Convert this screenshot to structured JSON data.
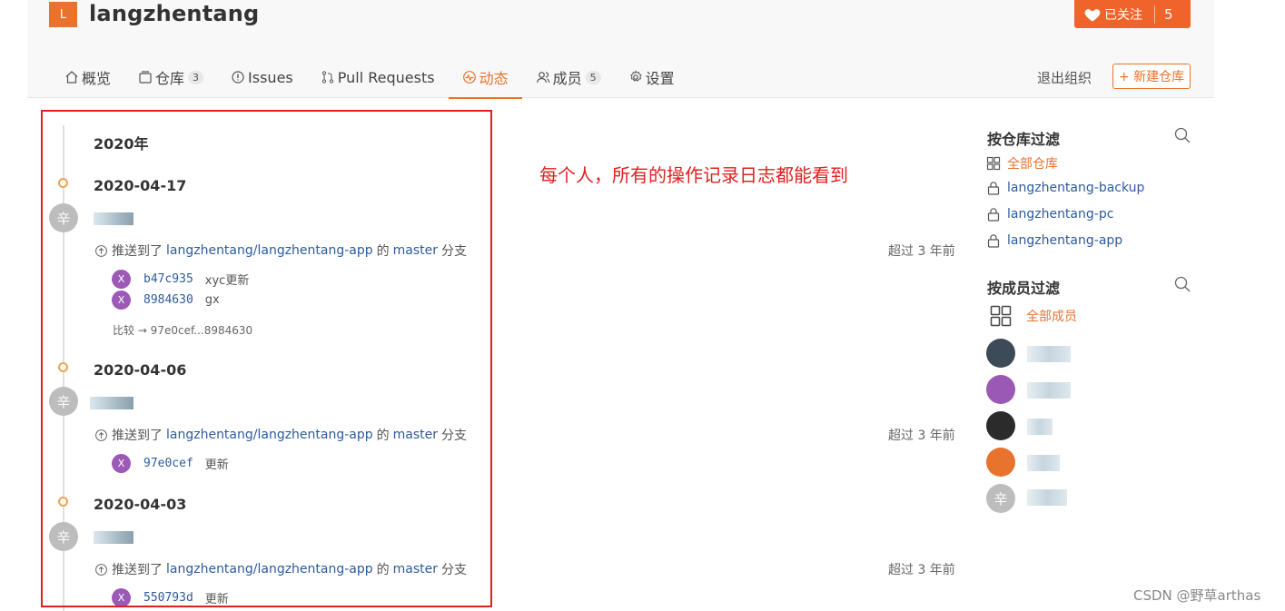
{
  "org": {
    "logo_letter": "L",
    "name": "langzhentang",
    "follow_label": "已关注",
    "follow_count": "5"
  },
  "tabs": [
    {
      "label": "概览",
      "icon": "home-icon"
    },
    {
      "label": "仓库",
      "icon": "repo-icon",
      "badge": "3"
    },
    {
      "label": "Issues",
      "icon": "issue-icon"
    },
    {
      "label": "Pull Requests",
      "icon": "pull-request-icon"
    },
    {
      "label": "动态",
      "icon": "activity-icon",
      "active": true
    },
    {
      "label": "成员",
      "icon": "members-icon",
      "badge": "5"
    },
    {
      "label": "设置",
      "icon": "gear-icon"
    }
  ],
  "header_actions": {
    "quit_org": "退出组织",
    "new_repo": "+ 新建仓库"
  },
  "timeline": {
    "year": "2020年",
    "avatar_char": "辛",
    "events": [
      {
        "date": "2020-04-17",
        "action": {
          "prefix": "推送到了",
          "repo": "langzhentang/langzhentang-app",
          "of": "的",
          "branch": "master",
          "suffix": "分支"
        },
        "time_ago": "超过 3 年前",
        "commits": [
          {
            "avatar": "X",
            "sha": "b47c935",
            "message": "xyc更新"
          },
          {
            "avatar": "X",
            "sha": "8984630",
            "message": "gx"
          }
        ],
        "compare": "比较 → 97e0cef...8984630"
      },
      {
        "date": "2020-04-06",
        "action": {
          "prefix": "推送到了",
          "repo": "langzhentang/langzhentang-app",
          "of": "的",
          "branch": "master",
          "suffix": "分支"
        },
        "time_ago": "超过 3 年前",
        "commits": [
          {
            "avatar": "X",
            "sha": "97e0cef",
            "message": "更新"
          }
        ]
      },
      {
        "date": "2020-04-03",
        "action": {
          "prefix": "推送到了",
          "repo": "langzhentang/langzhentang-app",
          "of": "的",
          "branch": "master",
          "suffix": "分支"
        },
        "time_ago": "超过 3 年前",
        "commits": [
          {
            "avatar": "X",
            "sha": "550793d",
            "message": "更新"
          }
        ]
      }
    ]
  },
  "annotation": "每个人，所有的操作记录日志都能看到",
  "sidebar": {
    "repo_filter": {
      "title": "按仓库过滤",
      "items": [
        {
          "label": "全部仓库",
          "icon": "grid-icon",
          "active": true
        },
        {
          "label": "langzhentang-backup",
          "icon": "lock-icon"
        },
        {
          "label": "langzhentang-pc",
          "icon": "lock-icon"
        },
        {
          "label": "langzhentang-app",
          "icon": "lock-icon"
        }
      ]
    },
    "member_filter": {
      "title": "按成员过滤",
      "all_label": "全部成员",
      "member_avatar_colors": [
        "#3d4a57",
        "#9b59b6",
        "#2b2b2b",
        "#e8732c",
        "#c0c0c0"
      ],
      "last_member_avatar_char": "辛"
    }
  },
  "watermark": "CSDN @野草arthas"
}
